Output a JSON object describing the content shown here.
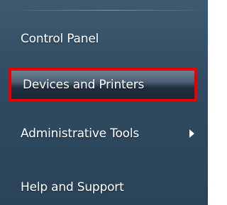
{
  "start_menu": {
    "items": [
      {
        "label": "Control Panel"
      },
      {
        "label": "Devices and Printers",
        "highlighted": true
      },
      {
        "label": "Administrative Tools",
        "has_submenu": true
      },
      {
        "label": "Help and Support"
      }
    ]
  },
  "colors": {
    "panel_background": "#2f4a60",
    "highlight_border": "#e80000",
    "text": "#ffffff"
  },
  "icons": {
    "submenu_arrow": "triangle-right-icon"
  }
}
